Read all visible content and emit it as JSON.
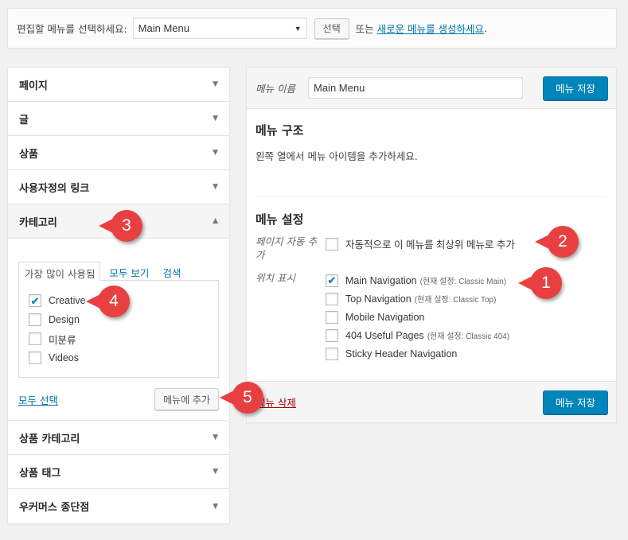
{
  "manage_bar": {
    "label": "편집할 메뉴를 선택하세요:",
    "selected_menu": "Main Menu",
    "select_button": "선택",
    "or_text": "또는",
    "create_link": "새로운 메뉴를 생성하세요",
    "period": "."
  },
  "accordion": {
    "items_top": [
      {
        "label": "페이지"
      },
      {
        "label": "글"
      },
      {
        "label": "상품"
      },
      {
        "label": "사용자정의 링크"
      }
    ],
    "open_item": {
      "label": "카테고리",
      "tabs": [
        {
          "label": "가장 많이 사용됨",
          "active": true
        },
        {
          "label": "모두 보기",
          "active": false
        },
        {
          "label": "검색",
          "active": false
        }
      ],
      "checkboxes": [
        {
          "label": "Creative",
          "checked": true
        },
        {
          "label": "Design",
          "checked": false
        },
        {
          "label": "미분류",
          "checked": false
        },
        {
          "label": "Videos",
          "checked": false
        }
      ],
      "select_all": "모두 선택",
      "add_button": "메뉴에 추가"
    },
    "items_bottom": [
      {
        "label": "상품 카테고리"
      },
      {
        "label": "상품 태그"
      },
      {
        "label": "우커머스 종단점"
      }
    ]
  },
  "menu_edit": {
    "name_label": "메뉴 이름",
    "name_value": "Main Menu",
    "save_button": "메뉴 저장",
    "structure_title": "메뉴 구조",
    "structure_hint": "왼쪽 열에서 메뉴 아이템을 추가하세요.",
    "settings_title": "메뉴 설정",
    "auto_add_label": "페이지 자동 추가",
    "auto_add_option": {
      "label": "자동적으로 이 메뉴를 최상위 메뉴로 추가",
      "checked": false
    },
    "locations_label": "위치 표시",
    "locations": [
      {
        "label": "Main Navigation",
        "note": "(현재 설정: Classic Main)",
        "checked": true
      },
      {
        "label": "Top Navigation",
        "note": "(현재 설정: Classic Top)",
        "checked": false
      },
      {
        "label": "Mobile Navigation",
        "note": "",
        "checked": false
      },
      {
        "label": "404 Useful Pages",
        "note": "(현재 설정: Classic 404)",
        "checked": false
      },
      {
        "label": "Sticky Header Navigation",
        "note": "",
        "checked": false
      }
    ],
    "delete_link": "메뉴 삭제",
    "footer_save_button": "메뉴 저장"
  },
  "markers": [
    "1",
    "2",
    "3",
    "4",
    "5"
  ],
  "icons": {
    "dropdown": "▼",
    "collapse": "▲",
    "check": "✔"
  },
  "colors": {
    "primary": "#0085ba",
    "link": "#0073aa",
    "delete": "#a00000",
    "marker": "#e84041"
  }
}
